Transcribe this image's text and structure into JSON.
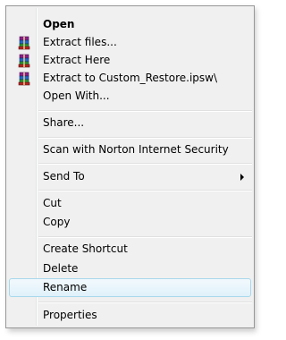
{
  "context_menu": {
    "items": [
      {
        "label": "Open",
        "bold": true
      },
      {
        "label": "Extract files...",
        "icon": "winrar-archive-icon"
      },
      {
        "label": "Extract Here",
        "icon": "winrar-archive-icon"
      },
      {
        "label": "Extract to Custom_Restore.ipsw\\",
        "icon": "winrar-archive-icon"
      },
      {
        "label": "Open With..."
      },
      {
        "label": "Share..."
      },
      {
        "label": "Scan with Norton Internet Security"
      },
      {
        "label": "Send To",
        "submenu": true
      },
      {
        "label": "Cut"
      },
      {
        "label": "Copy"
      },
      {
        "label": "Create Shortcut"
      },
      {
        "label": "Delete"
      },
      {
        "label": "Rename",
        "highlighted": true
      },
      {
        "label": "Properties"
      }
    ],
    "colors": {
      "background": "#f0f0f0",
      "border": "#979797",
      "highlight_border": "#a8d8eb",
      "highlight_fill": "#e6f3fb"
    }
  }
}
